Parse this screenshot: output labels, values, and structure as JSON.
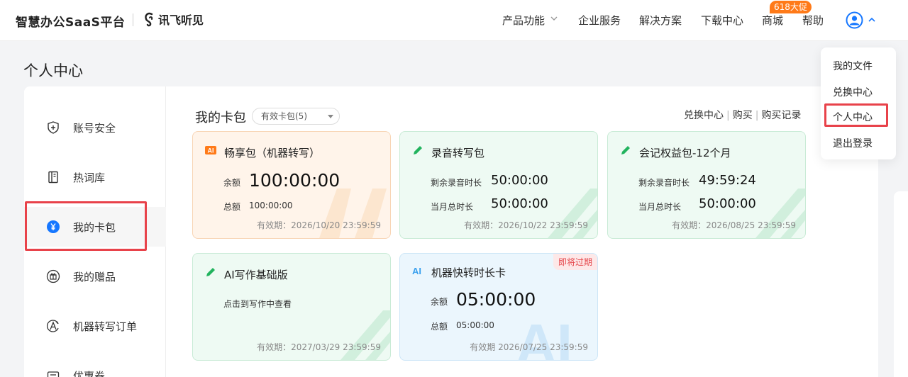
{
  "header": {
    "brand": "智慧办公SaaS平台",
    "logo_text": "讯飞听见",
    "nav": {
      "product": "产品功能",
      "enterprise": "企业服务",
      "solutions": "解决方案",
      "download": "下载中心",
      "mall": "商城",
      "help": "帮助"
    },
    "promo_badge": "618大促"
  },
  "page_title": "个人中心",
  "sidebar": {
    "items": [
      {
        "label": "账号安全",
        "icon": "shield-icon"
      },
      {
        "label": "热词库",
        "icon": "book-icon"
      },
      {
        "label": "我的卡包",
        "icon": "yen-coin-icon"
      },
      {
        "label": "我的赠品",
        "icon": "gift-icon"
      },
      {
        "label": "机器转写订单",
        "icon": "ai-order-icon"
      },
      {
        "label": "优惠券",
        "icon": "coupon-icon"
      }
    ]
  },
  "wallet": {
    "title": "我的卡包",
    "filter": "有效卡包(5)",
    "links": [
      "兑换中心",
      "购买",
      "购买记录"
    ]
  },
  "cards": [
    {
      "title": "畅享包（机器转写）",
      "icon": "ai-badge-icon",
      "rows": [
        {
          "label": "余额",
          "value": "100:00:00"
        },
        {
          "label": "总额",
          "value": "100:00:00"
        }
      ],
      "expiry": "有效期：2026/10/20 23:59:59"
    },
    {
      "title": "录音转写包",
      "icon": "pen-icon",
      "rows": [
        {
          "label": "剩余录音时长",
          "value": "50:00:00"
        },
        {
          "label": "当月总时长",
          "value": "50:00:00"
        }
      ],
      "expiry": "有效期：2026/10/22 23:59:59"
    },
    {
      "title": "会记权益包-12个月",
      "icon": "pen-icon",
      "rows": [
        {
          "label": "剩余录音时长",
          "value": "49:59:24"
        },
        {
          "label": "当月总时长",
          "value": "50:00:00"
        }
      ],
      "expiry": "有效期：2026/08/25 23:59:59"
    },
    {
      "title": "AI写作基础版",
      "icon": "pen-icon",
      "desc": "点击到写作中查看",
      "expiry": "有效期：2027/03/29 23:59:59"
    },
    {
      "title": "机器快转时长卡",
      "icon": "ai-letters-icon",
      "tag": "即将过期",
      "rows": [
        {
          "label": "余额",
          "value": "05:00:00"
        },
        {
          "label": "总额",
          "value": "05:00:00"
        }
      ],
      "expiry": "有效期 2026/07/25 23:59:59"
    }
  ],
  "user_menu": {
    "items": [
      "我的文件",
      "兑换中心",
      "个人中心",
      "退出登录"
    ]
  },
  "colors": {
    "highlight": "#e8424a",
    "brand_blue": "#1677ff",
    "promo": "#ff7a18",
    "green_icon": "#22b35e"
  }
}
